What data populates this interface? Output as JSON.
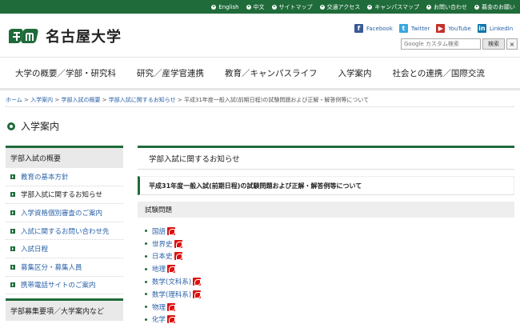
{
  "topbar": {
    "links": [
      "English",
      "中文",
      "サイトマップ",
      "交通アクセス",
      "キャンパスマップ",
      "お問い合わせ",
      "募金のお願い"
    ]
  },
  "header": {
    "logo_text": "名古屋大学"
  },
  "social": {
    "facebook": "Facebook",
    "twitter": "Twitter",
    "youtube": "YouTube",
    "linkedin": "LinkedIn"
  },
  "search": {
    "placeholder": "Google カスタム検索",
    "button": "検索",
    "clear": "×"
  },
  "global_nav": [
    "大学の概要／学部・研究科",
    "研究／産学官連携",
    "教育／キャンパスライフ",
    "入学案内",
    "社会との連携／国際交流"
  ],
  "breadcrumb": {
    "items": [
      "ホーム",
      "入学案内",
      "学部入試の概要",
      "学部入試に関するお知らせ"
    ],
    "separator": " > ",
    "current": "平成31年度一般入試(前期日程)の試験問題および正解・解答例等について"
  },
  "page_title": "入学案内",
  "sidebar": {
    "heading": "学部入試の概要",
    "items": [
      "教育の基本方針",
      "学部入試に関するお知らせ",
      "入学資格個別審査のご案内",
      "入試に関するお問い合わせ先",
      "入試日程",
      "募集区分・募集人員",
      "携帯電話サイトのご案内"
    ],
    "heading2": "学部募集要項／大学案内など"
  },
  "main": {
    "heading": "学部入試に関するお知らせ",
    "notice_title": "平成31年度一般入試(前期日程)の試験問題および正解・解答例等について",
    "section_title": "試験問題",
    "files": [
      "国語",
      "世界史",
      "日本史",
      "地理",
      "数学(文科系)",
      "数学(理科系)",
      "物理",
      "化学"
    ]
  },
  "colors": {
    "brand_green": "#1f6b3a",
    "link_blue": "#2a62a8",
    "pdf_red": "#dd1111"
  }
}
